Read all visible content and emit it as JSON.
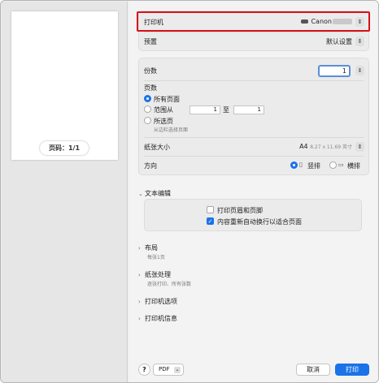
{
  "preview": {
    "page_indicator": "页码：1/1"
  },
  "printer": {
    "label": "打印机",
    "value": "Canon"
  },
  "presets": {
    "label": "预置",
    "value": "默认设置"
  },
  "copies": {
    "label": "份数",
    "value": "1"
  },
  "pages": {
    "label": "页数",
    "all": "所有页面",
    "range": "范围从",
    "range_from": "1",
    "range_to_label": "至",
    "range_to": "1",
    "selected": "所选页",
    "selected_hint": "从边栏选择页面"
  },
  "paper_size": {
    "label": "纸张大小",
    "value": "A4",
    "detail": "8.27 x 11.69 英寸"
  },
  "orientation": {
    "label": "方向",
    "portrait": "竖排",
    "landscape": "横排"
  },
  "text_edit": {
    "title": "文本编辑",
    "header_footer": "打印页眉和页脚",
    "rewrap": "内容重新自动换行以适合页面"
  },
  "sections": [
    {
      "title": "布局",
      "subtitle": "每张1页"
    },
    {
      "title": "纸张处理",
      "subtitle": "逐张打印、所有张数"
    },
    {
      "title": "打印机选项",
      "subtitle": ""
    },
    {
      "title": "打印机信息",
      "subtitle": ""
    }
  ],
  "footer": {
    "help": "?",
    "pdf": "PDF",
    "cancel": "取消",
    "print": "打印"
  },
  "colors": {
    "accent": "#1a73e8",
    "highlight": "#d6111a"
  }
}
